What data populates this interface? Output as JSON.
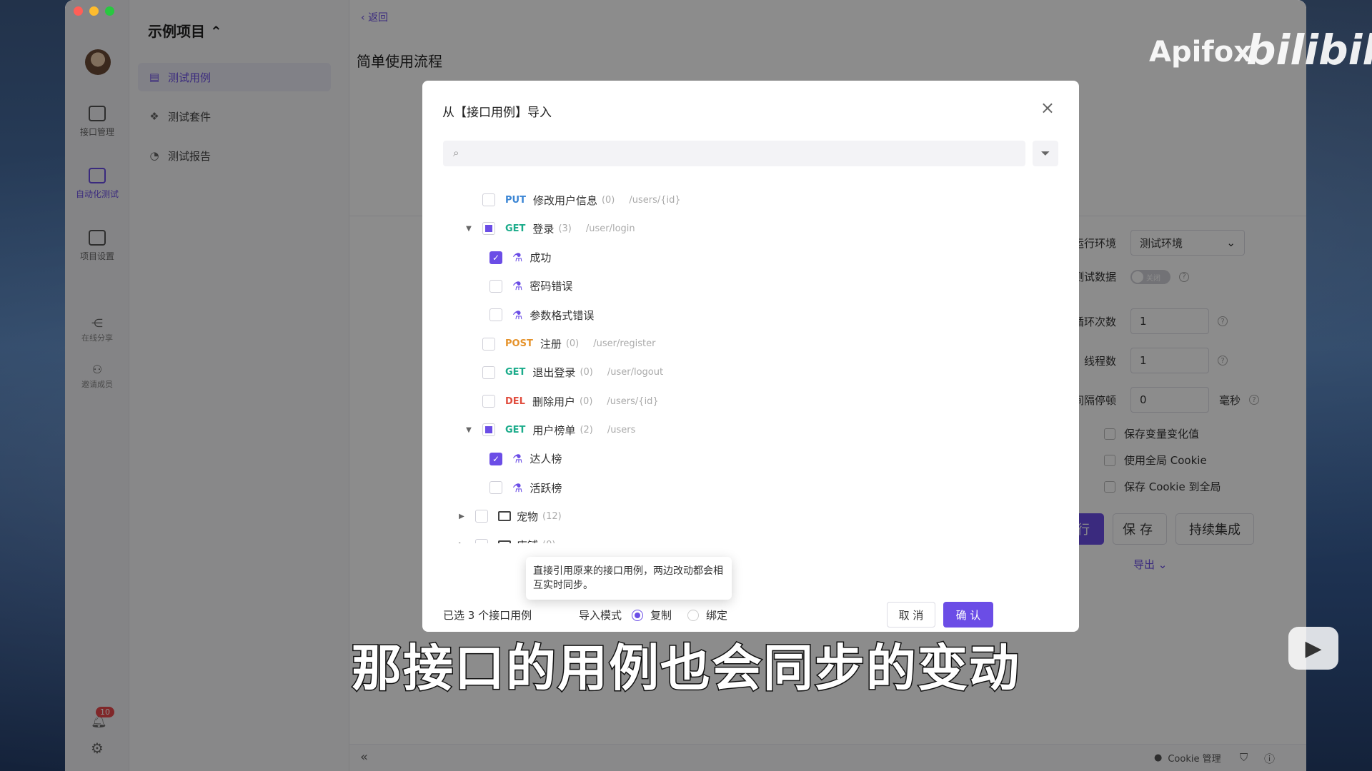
{
  "rail": {
    "items": [
      {
        "label": "接口管理"
      },
      {
        "label": "自动化测试"
      },
      {
        "label": "项目设置"
      }
    ],
    "small": [
      {
        "label": "在线分享"
      },
      {
        "label": "邀请成员"
      }
    ],
    "badge": "10"
  },
  "nav2": {
    "project": "示例项目",
    "items": [
      {
        "label": "测试用例"
      },
      {
        "label": "测试套件"
      },
      {
        "label": "测试报告"
      }
    ]
  },
  "main": {
    "back": "返回",
    "title": "简单使用流程"
  },
  "settings": {
    "env_label": "运行环境",
    "env_value": "测试环境",
    "data_label": "测试数据",
    "data_toggle": "关闭",
    "loop_label": "循环次数",
    "loop_value": "1",
    "thread_label": "线程数",
    "thread_value": "1",
    "interval_label": "间隔停顿",
    "interval_value": "0",
    "interval_unit": "毫秒",
    "checkboxes": [
      "保存变量变化值",
      "使用全局 Cookie",
      "保存 Cookie 到全局"
    ],
    "run": "运行",
    "save": "保存",
    "ci": "持续集成",
    "export": "导出"
  },
  "bottom": {
    "cookie": "Cookie 管理"
  },
  "modal": {
    "title": "从【接口用例】导入",
    "rows": [
      {
        "type": "endpoint",
        "method": "PUT",
        "method_class": "put",
        "name": "修改用户信息",
        "count": "(0)",
        "path": "/users/{id}"
      },
      {
        "type": "endpoint",
        "method": "GET",
        "method_class": "get",
        "name": "登录",
        "count": "(3)",
        "path": "/user/login"
      },
      {
        "type": "case",
        "name": "成功",
        "checked": true
      },
      {
        "type": "case",
        "name": "密码错误",
        "checked": false
      },
      {
        "type": "case",
        "name": "参数格式错误",
        "checked": false
      },
      {
        "type": "endpoint",
        "method": "POST",
        "method_class": "post",
        "name": "注册",
        "count": "(0)",
        "path": "/user/register"
      },
      {
        "type": "endpoint",
        "method": "GET",
        "method_class": "get",
        "name": "退出登录",
        "count": "(0)",
        "path": "/user/logout"
      },
      {
        "type": "endpoint",
        "method": "DEL",
        "method_class": "del",
        "name": "删除用户",
        "count": "(0)",
        "path": "/users/{id}"
      },
      {
        "type": "endpoint",
        "method": "GET",
        "method_class": "get",
        "name": "用户榜单",
        "count": "(2)",
        "path": "/users"
      },
      {
        "type": "case",
        "name": "达人榜",
        "checked": true
      },
      {
        "type": "case",
        "name": "活跃榜",
        "checked": false
      },
      {
        "type": "folder",
        "name": "宠物",
        "count": "(12)"
      },
      {
        "type": "folder",
        "name": "店铺",
        "count": "(0)"
      }
    ],
    "tooltip": "直接引用原来的接口用例，两边改动都会相互实时同步。",
    "selected": "已选 3 个接口用例",
    "mode_label": "导入模式",
    "mode_copy": "复制",
    "mode_bind": "绑定",
    "cancel": "取 消",
    "confirm": "确 认"
  },
  "subtitle": "那接口的用例也会同步的变动",
  "watermark": {
    "apifox": "Apifox",
    "bili": "bilibili"
  }
}
